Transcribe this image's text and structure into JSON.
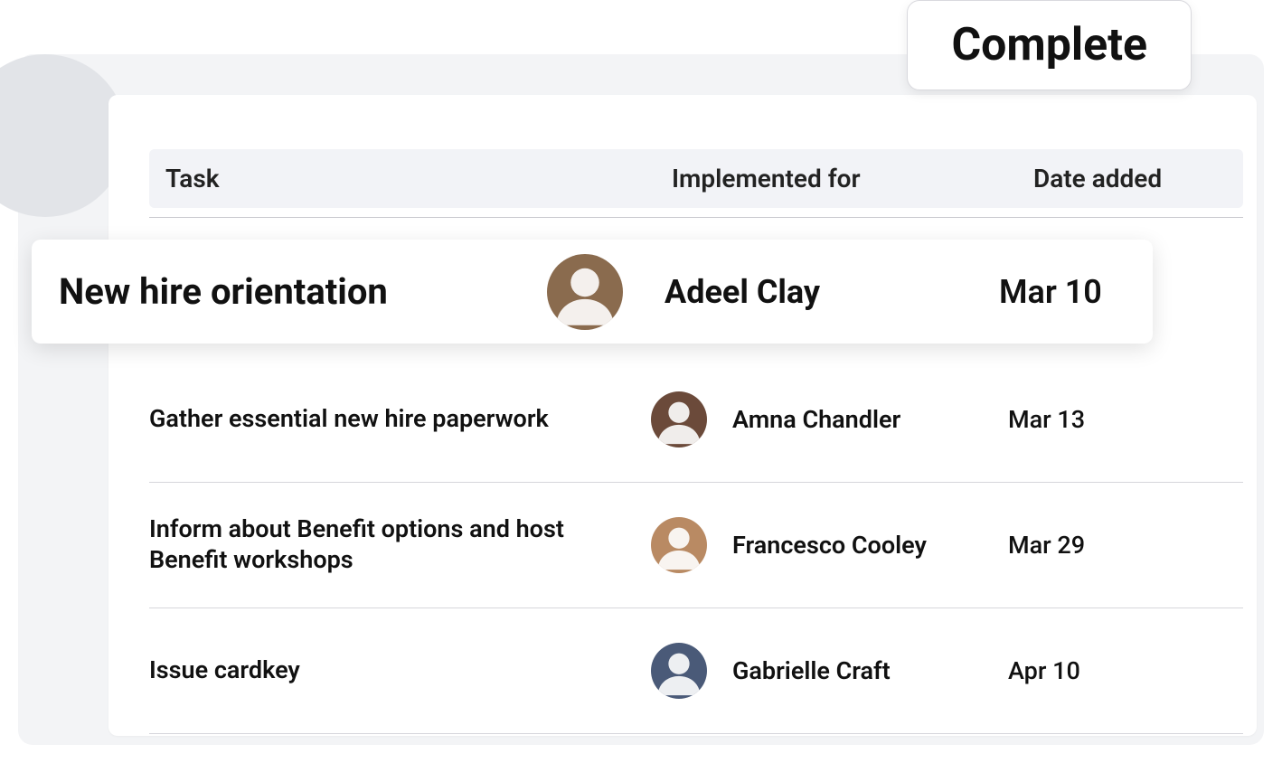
{
  "tab": {
    "label": "Complete"
  },
  "table": {
    "columns": {
      "task": "Task",
      "implemented_for": "Implemented for",
      "date_added": "Date added"
    },
    "highlight": {
      "task": "New hire orientation",
      "person": "Adeel Clay",
      "date": "Mar 10",
      "avatar_color": "#8a6b4e"
    },
    "rows": [
      {
        "task": "Gather essential new hire paperwork",
        "person": "Amna Chandler",
        "date": "Mar 13",
        "avatar_color": "#6b4a3a"
      },
      {
        "task": "Inform about Benefit options and host Benefit workshops",
        "person": "Francesco Cooley",
        "date": "Mar 29",
        "avatar_color": "#b98a63"
      },
      {
        "task": "Issue cardkey",
        "person": "Gabrielle Craft",
        "date": "Apr 10",
        "avatar_color": "#4a5a78"
      }
    ]
  }
}
